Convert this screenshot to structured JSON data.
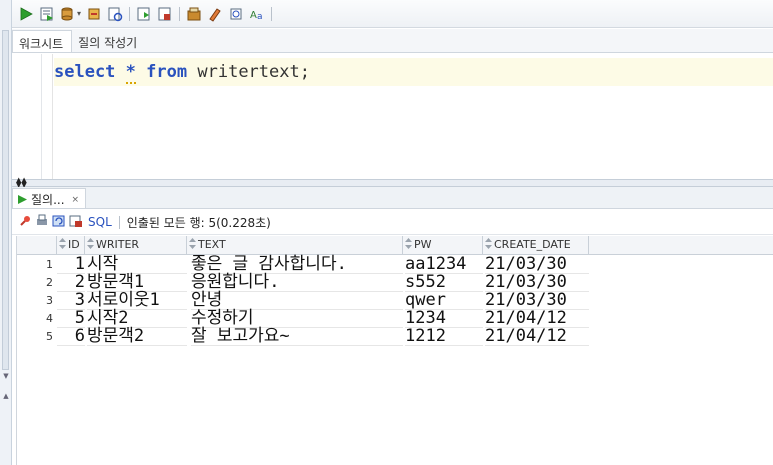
{
  "toolbar": {
    "icons": [
      "run-statement-icon",
      "run-script-icon",
      "commit-icon",
      "rollback-icon",
      "autotrace-icon",
      "explain-plan-icon",
      "sql-tuning-icon",
      "clear-icon",
      "history-icon",
      "format-icon",
      "case-icon"
    ]
  },
  "worksheet_tabs": [
    {
      "label": "워크시트"
    },
    {
      "label": "질의 작성기"
    }
  ],
  "editor": {
    "keyword_select": "select",
    "star": "*",
    "keyword_from": "from",
    "table": "writertext",
    "semicolon": ";"
  },
  "results": {
    "tab_label": "질의...",
    "tab_close": "×",
    "sql_label": "SQL",
    "status": "인출된 모든 행: 5(0.228초)",
    "columns": [
      "ID",
      "WRITER",
      "TEXT",
      "PW",
      "CREATE_DATE"
    ],
    "rows": [
      {
        "rownum": "1",
        "id": "1",
        "writer": "시작",
        "text": "좋은 글 감사합니다.",
        "pw": "aa1234",
        "create_date": "21/03/30"
      },
      {
        "rownum": "2",
        "id": "2",
        "writer": "방문객1",
        "text": "응원합니다.",
        "pw": "s552",
        "create_date": "21/03/30"
      },
      {
        "rownum": "3",
        "id": "3",
        "writer": "서로이웃1",
        "text": "안녕",
        "pw": "qwer",
        "create_date": "21/03/30"
      },
      {
        "rownum": "4",
        "id": "5",
        "writer": "시작2",
        "text": "수정하기",
        "pw": "1234",
        "create_date": "21/04/12"
      },
      {
        "rownum": "5",
        "id": "6",
        "writer": "방문객2",
        "text": "잘 보고가요~",
        "pw": "1212",
        "create_date": "21/04/12"
      }
    ]
  },
  "colors": {
    "keyword": "#2a52be",
    "current_line": "#fdfbe6",
    "run_green": "#2e9e2e"
  }
}
